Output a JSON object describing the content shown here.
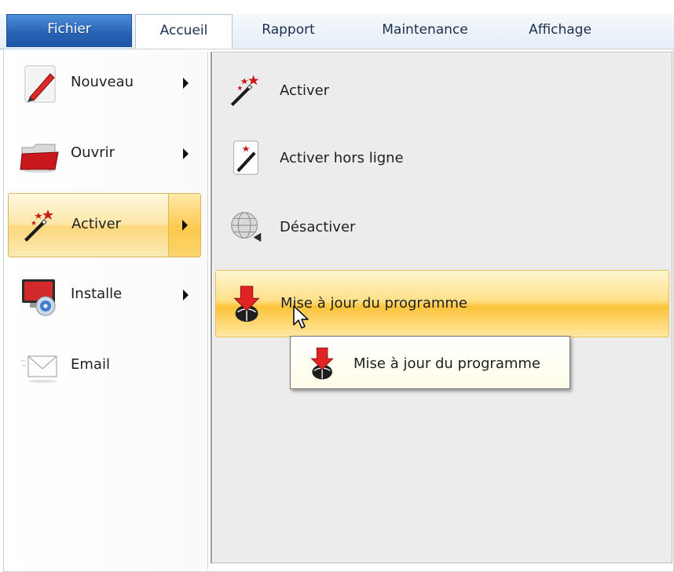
{
  "ribbon": {
    "file_tab": "Fichier",
    "tabs": [
      {
        "label": "Accueil",
        "active": true
      },
      {
        "label": "Rapport",
        "active": false
      },
      {
        "label": "Maintenance",
        "active": false
      },
      {
        "label": "Affichage",
        "active": false
      }
    ]
  },
  "left_menu": {
    "items": [
      {
        "label": "Nouveau",
        "icon": "pencil-icon",
        "has_submenu": true,
        "selected": false
      },
      {
        "label": "Ouvrir",
        "icon": "folder-icon",
        "has_submenu": true,
        "selected": false
      },
      {
        "label": "Activer",
        "icon": "magic-wand-icon",
        "has_submenu": true,
        "selected": true
      },
      {
        "label": "Installe",
        "icon": "install-disc-icon",
        "has_submenu": true,
        "selected": false
      },
      {
        "label": "Email",
        "icon": "envelope-icon",
        "has_submenu": false,
        "selected": false
      }
    ]
  },
  "submenu": {
    "items": [
      {
        "label": "Activer",
        "icon": "magic-wand-icon",
        "hover": false
      },
      {
        "label": "Activer hors ligne",
        "icon": "magic-wand-offline-icon",
        "hover": false
      },
      {
        "label": "Désactiver",
        "icon": "globe-deactivate-icon",
        "hover": false
      },
      {
        "label": "Mise à jour du programme",
        "icon": "update-download-icon",
        "hover": true
      }
    ]
  },
  "tooltip": {
    "label": "Mise à jour du programme",
    "icon": "update-download-icon"
  },
  "colors": {
    "file_tab": "#2a63b6",
    "selection_gold": "#fcc43b",
    "panel_bg": "#ececec"
  }
}
